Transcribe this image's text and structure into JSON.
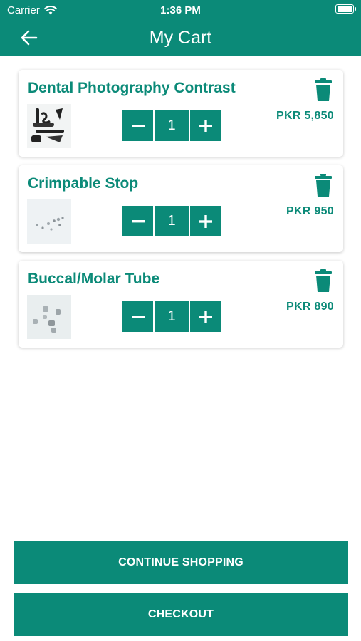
{
  "status_bar": {
    "carrier": "Carrier",
    "time": "1:36 PM"
  },
  "header": {
    "title": "My Cart"
  },
  "cart": {
    "items": [
      {
        "name": "Dental Photography Contrast",
        "quantity": "1",
        "price": "PKR 5,850"
      },
      {
        "name": "Crimpable Stop",
        "quantity": "1",
        "price": "PKR 950"
      },
      {
        "name": "Buccal/Molar Tube",
        "quantity": "1",
        "price": "PKR 890"
      }
    ]
  },
  "actions": {
    "continue_label": "CONTINUE SHOPPING",
    "checkout_label": "CHECKOUT"
  },
  "colors": {
    "primary": "#0b8a78",
    "background": "#ffffff"
  },
  "icons": {
    "back": "arrow-left-icon",
    "delete": "trash-icon",
    "decrement": "minus-icon",
    "increment": "plus-icon",
    "wifi": "wifi-icon",
    "battery": "battery-icon"
  }
}
